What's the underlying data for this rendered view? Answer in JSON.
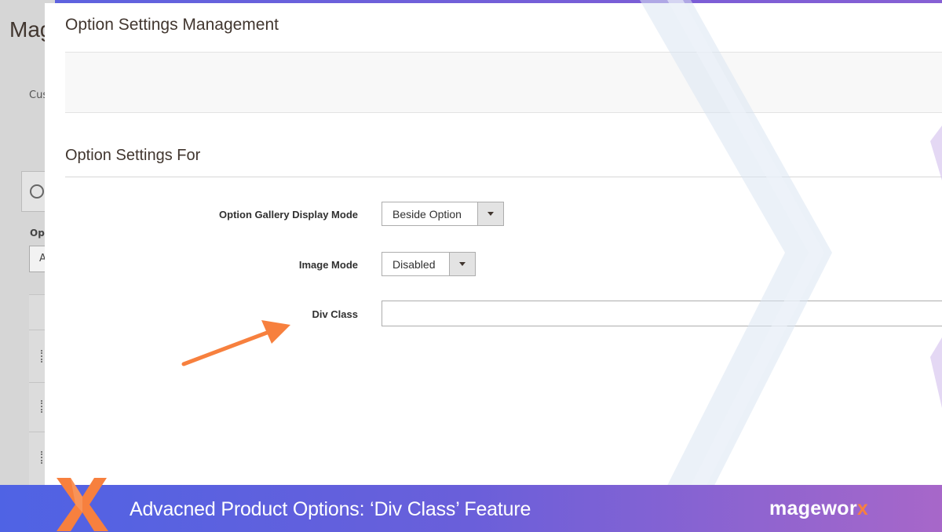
{
  "background_page": {
    "title_fragment": "Mag",
    "label_fragment": "Cus",
    "options_fragment": "Op",
    "select_fragment": "A"
  },
  "modal": {
    "title": "Option Settings Management",
    "section_title": "Option Settings For",
    "fields": {
      "gallery_mode": {
        "label": "Option Gallery Display Mode",
        "value": "Beside Option"
      },
      "image_mode": {
        "label": "Image Mode",
        "value": "Disabled"
      },
      "div_class": {
        "label": "Div Class",
        "value": ""
      }
    }
  },
  "banner": {
    "title": "Advacned Product Options: ‘Div Class’ Feature",
    "brand_main": "magewor",
    "brand_accent": "x"
  },
  "colors": {
    "frame_purple": "#6a5fd8",
    "arrow_orange": "#f7803e",
    "brand_orange": "#f7803e"
  },
  "icons": {
    "annotation": "arrow-icon",
    "logo": "x-logo-icon",
    "dropdown": "chevron-down-icon"
  }
}
